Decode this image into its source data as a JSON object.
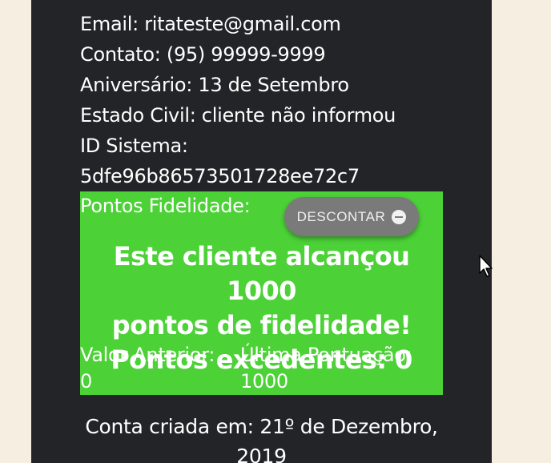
{
  "client": {
    "email": "Email: ritateste@gmail.com",
    "contact": "Contato: (95) 99999-9999",
    "birthday": "Aniversário: 13 de Setembro",
    "civil_status": "Estado Civil: cliente não informou",
    "system_id_label": "ID Sistema:",
    "system_id_value": "5dfe96b86573501728ee72c7"
  },
  "points": {
    "label": "Pontos Fidelidade:",
    "discount_button": "DESCONTAR",
    "discount_icon": "minus-circle-icon",
    "achievement_line1": "Este cliente alcançou 1000",
    "achievement_line2": "pontos de fidelidade!",
    "excess": "Pontos excedentes: 0",
    "previous_label": "Valor Anterior:",
    "previous_value": "0",
    "last_label": "Última Pontuação:",
    "last_value": "1000",
    "box_color": "#4cd137"
  },
  "account": {
    "created_line1": "Conta criada em: 21º de Dezembro,",
    "created_line2": "2019"
  },
  "colors": {
    "page_bg": "#f5eee1",
    "card_bg": "#232427",
    "button_bg": "#7a7a7a"
  }
}
